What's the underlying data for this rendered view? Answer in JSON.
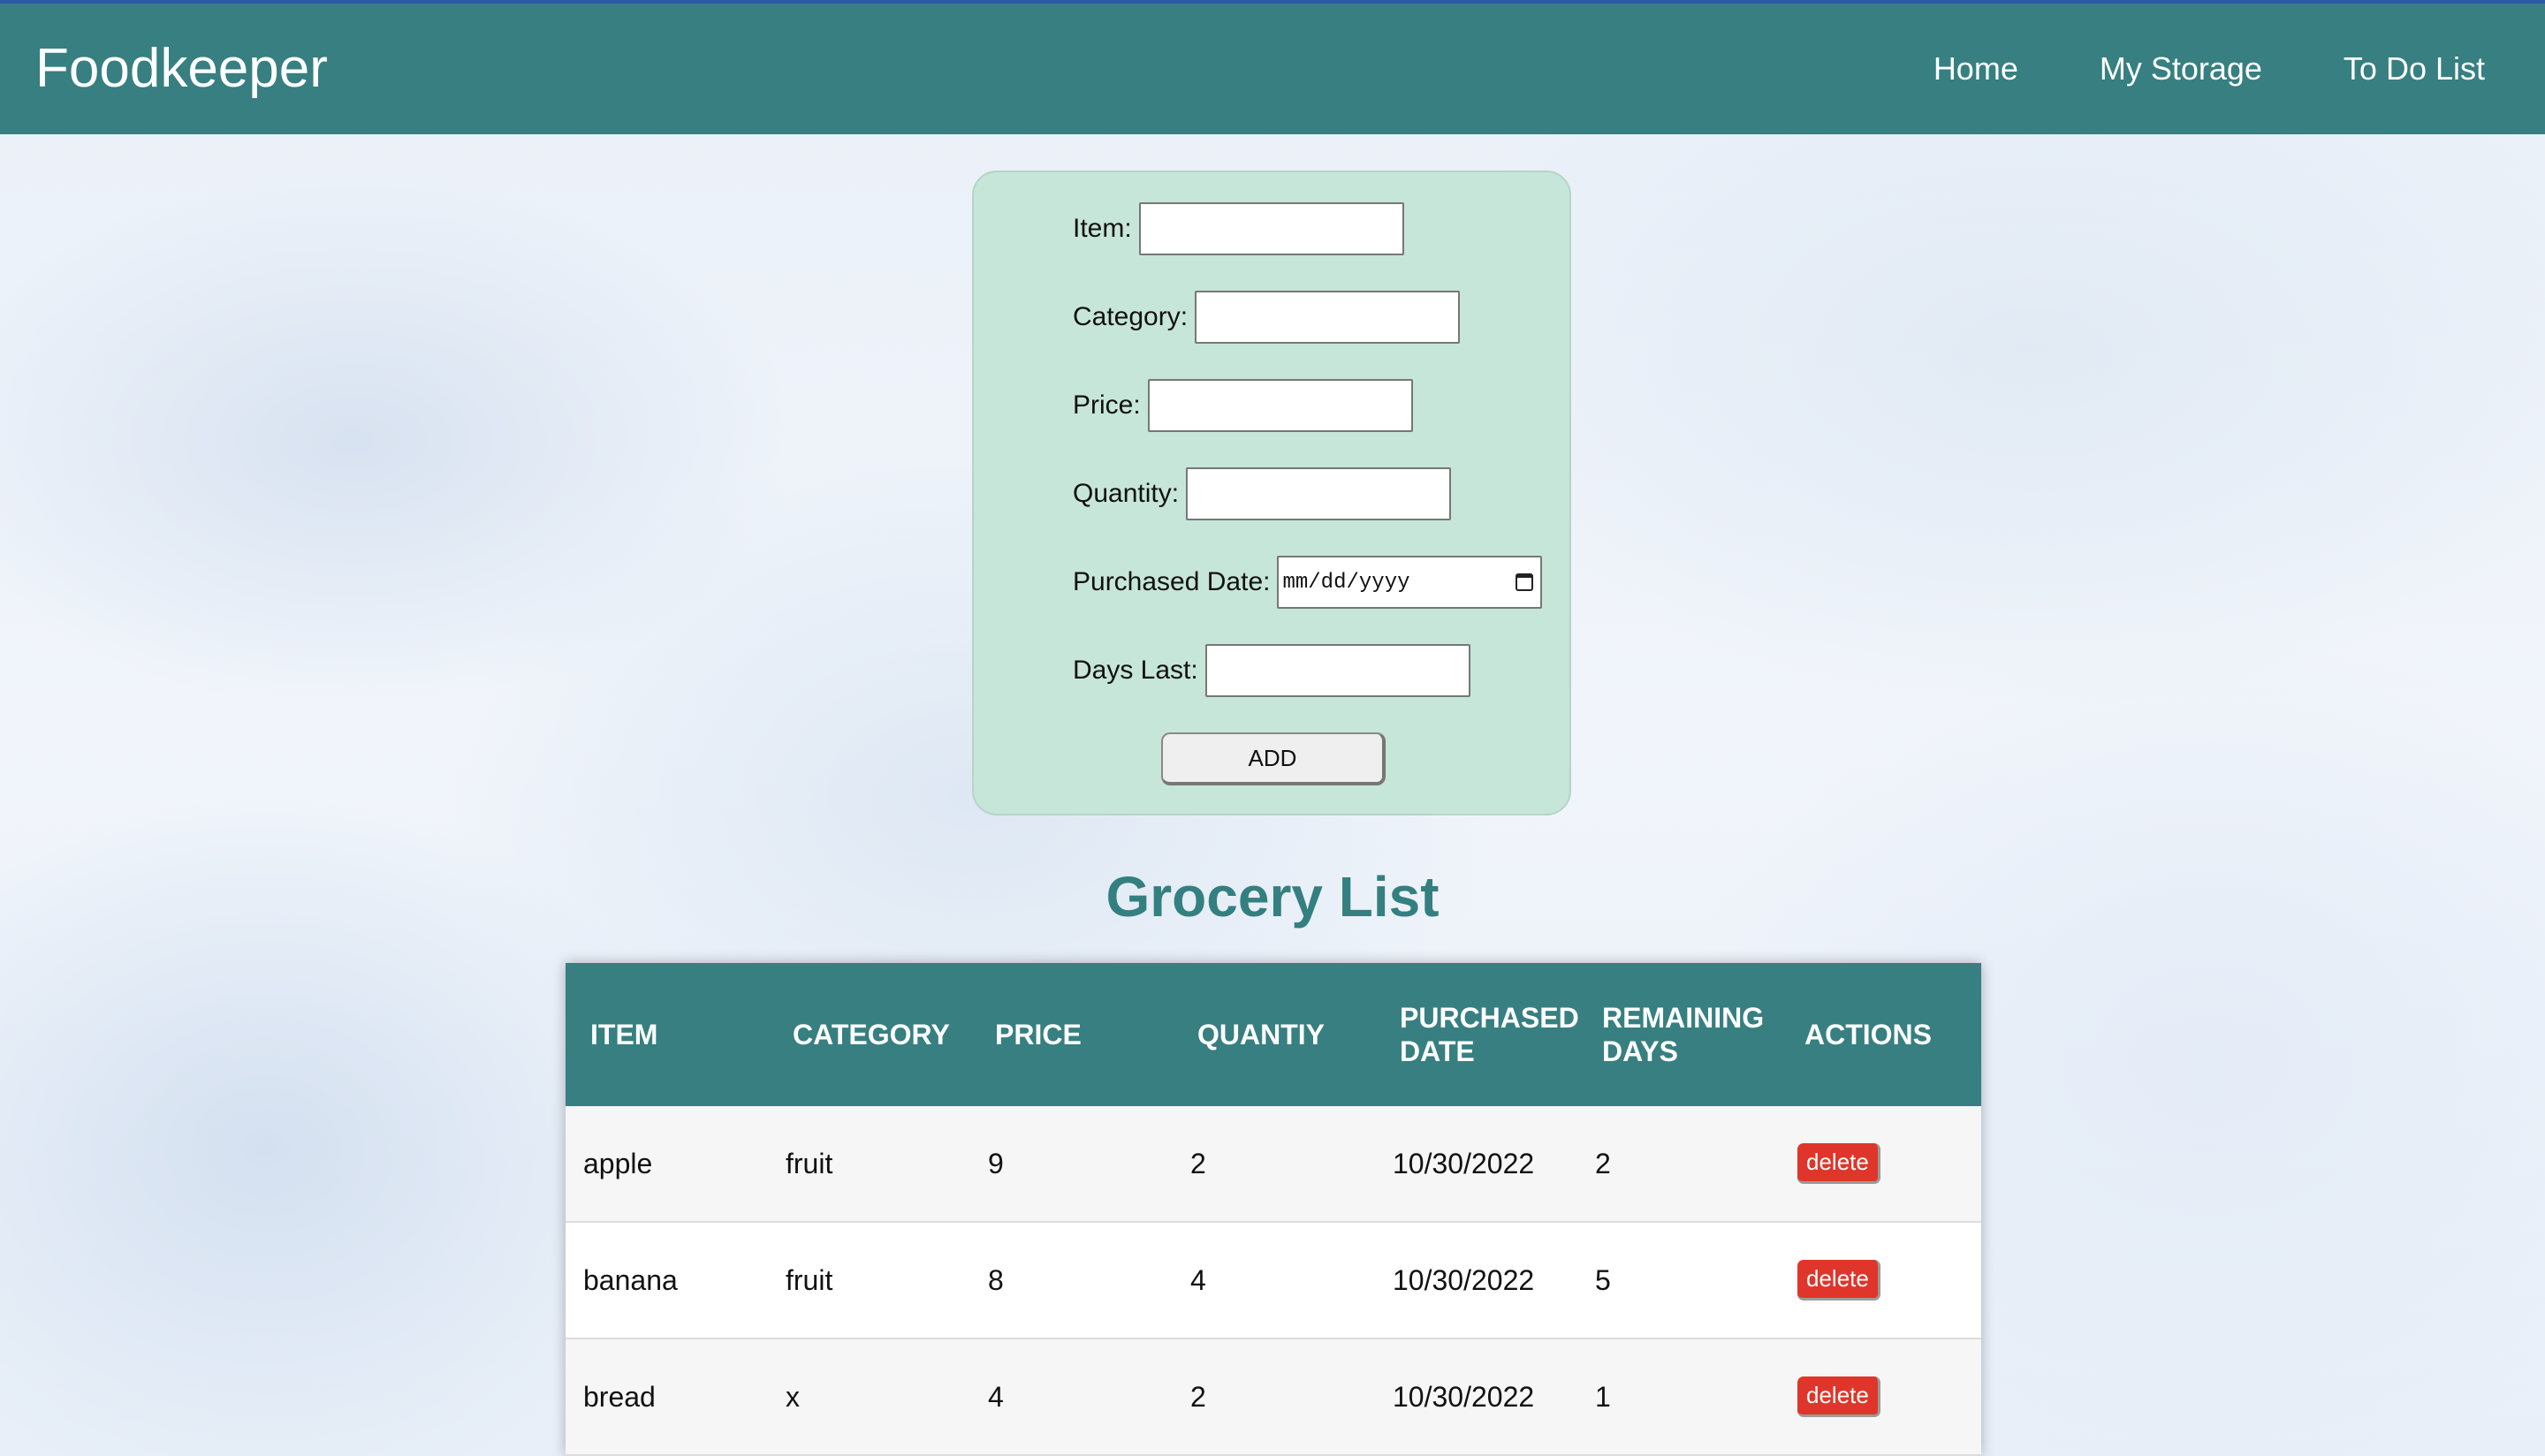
{
  "app": {
    "brand": "Foodkeeper"
  },
  "nav": {
    "links": [
      "Home",
      "My Storage",
      "To Do List"
    ]
  },
  "form": {
    "item_label": "Item:",
    "category_label": "Category:",
    "price_label": "Price:",
    "quantity_label": "Quantity:",
    "purchased_date_label": "Purchased Date:",
    "purchased_date_placeholder": "mm/dd/yyyy",
    "days_last_label": "Days Last:",
    "add_button": "ADD"
  },
  "list": {
    "title": "Grocery List",
    "headers": [
      "ITEM",
      "CATEGORY",
      "PRICE",
      "QUANTIY",
      "PURCHASED DATE",
      "REMAINING DAYS",
      "ACTIONS"
    ],
    "delete_label": "delete",
    "rows": [
      {
        "item": "apple",
        "category": "fruit",
        "price": "9",
        "quantity": "2",
        "purchased_date": "10/30/2022",
        "remaining_days": "2"
      },
      {
        "item": "banana",
        "category": "fruit",
        "price": "8",
        "quantity": "4",
        "purchased_date": "10/30/2022",
        "remaining_days": "5"
      },
      {
        "item": "bread",
        "category": "x",
        "price": "4",
        "quantity": "2",
        "purchased_date": "10/30/2022",
        "remaining_days": "1"
      }
    ]
  },
  "colors": {
    "navbar": "#377f80",
    "form_bg": "#c6e6d9",
    "title": "#347f80",
    "delete": "#e0352a"
  }
}
